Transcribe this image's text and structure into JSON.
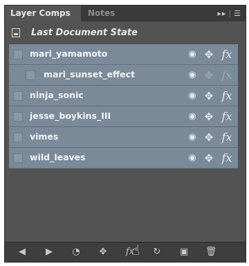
{
  "tabs": {
    "active": "Layer Comps",
    "inactive": "Notes"
  },
  "tab_controls": {
    "collapse": "▸▸",
    "menu": "☰"
  },
  "last_state_label": "Last Document State",
  "comps": [
    {
      "name": "mari_yamamoto",
      "indent": 0
    },
    {
      "name": "mari_sunset_effect",
      "indent": 1
    },
    {
      "name": "ninja_sonic",
      "indent": 0
    },
    {
      "name": "jesse_boykins_III",
      "indent": 0
    },
    {
      "name": "vimes",
      "indent": 0
    },
    {
      "name": "wild_leaves",
      "indent": 0
    }
  ],
  "row_icons": {
    "eye": "◉",
    "move": "✥",
    "fx": "fx"
  },
  "bottom_buttons": [
    {
      "name": "previous-comp-button",
      "glyph": "◀"
    },
    {
      "name": "next-comp-button",
      "glyph": "▶"
    },
    {
      "name": "apply-visibility-button",
      "glyph": "◔"
    },
    {
      "name": "apply-position-button",
      "glyph": "✥"
    },
    {
      "name": "apply-style-button",
      "glyph": "fx"
    },
    {
      "name": "update-comp-button",
      "glyph": "↻"
    },
    {
      "name": "new-comp-button",
      "glyph": "▣"
    },
    {
      "name": "delete-comp-button",
      "glyph": "🗑"
    }
  ],
  "colors": {
    "panel_bg": "#535353",
    "row_selected": "#7a8a99",
    "tabbar_bg": "#3a3a3a"
  }
}
